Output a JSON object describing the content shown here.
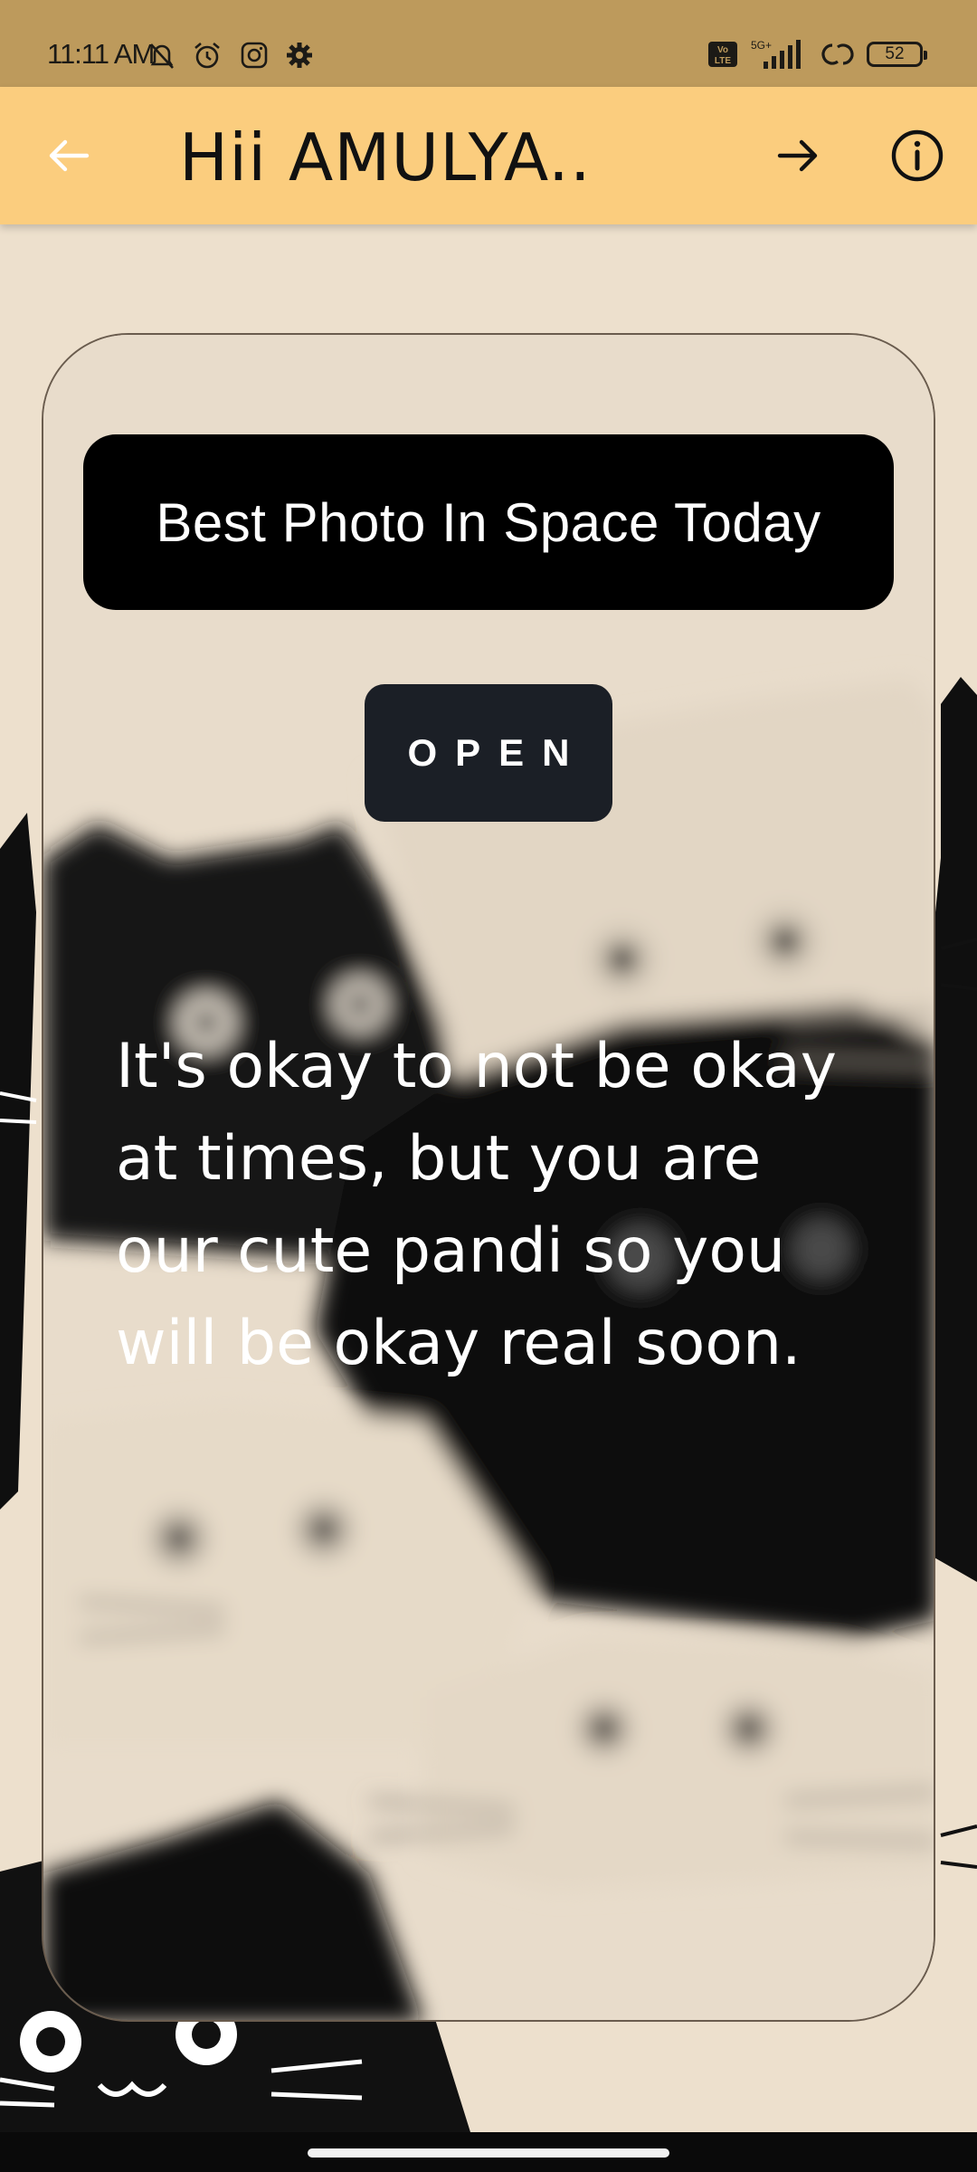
{
  "status_bar": {
    "time": "11:11 AM",
    "icons": [
      "mute-bell-icon",
      "alarm-icon",
      "instagram-icon",
      "settings-gear-icon"
    ],
    "network": "5G+",
    "volte": "Vo LTE",
    "battery": "52"
  },
  "app_bar": {
    "title": "Hii AMULYA..",
    "back_icon": "arrow-left-icon",
    "forward_icon": "arrow-right-icon",
    "info_icon": "info-circle-icon",
    "color": "#fbcd7e"
  },
  "card": {
    "headline": "Best Photo In Space Today",
    "open_label": "OPEN",
    "quote": "It's okay to not be okay at times, but you are our cute pandi so you will be okay real soon."
  },
  "colors": {
    "background": "#ede0cd",
    "status_bar": "#bd9a5c",
    "button_dark": "#1b1f26"
  }
}
